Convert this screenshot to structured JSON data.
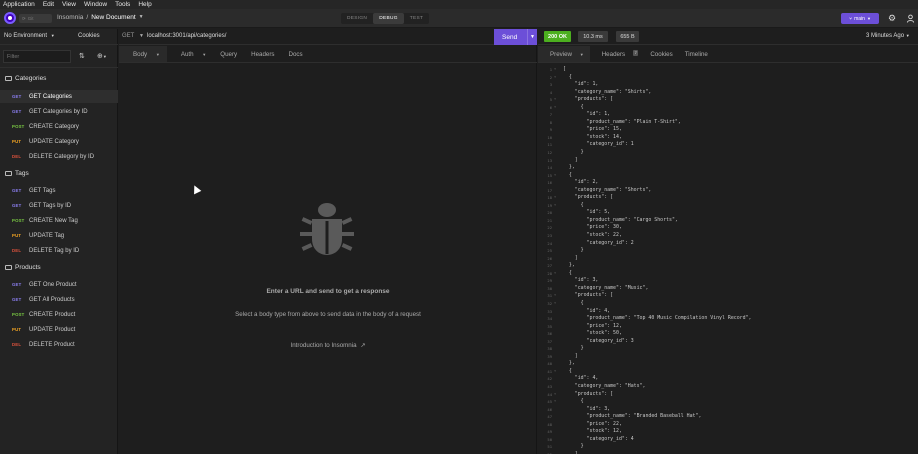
{
  "menu": [
    "Application",
    "Edit",
    "View",
    "Window",
    "Tools",
    "Help"
  ],
  "titlebar": {
    "git_label": "Git",
    "app_name": "Insomnia",
    "separator": "/",
    "document": "New Document",
    "modes": [
      "DESIGN",
      "DEBUG",
      "TEST"
    ],
    "active_mode": "DEBUG",
    "branch": "main"
  },
  "sidebar": {
    "environment": "No Environment",
    "cookies": "Cookies",
    "filter_placeholder": "Filter",
    "folders": [
      {
        "name": "Categories",
        "requests": [
          {
            "method": "GET",
            "name": "GET Categories"
          },
          {
            "method": "GET",
            "name": "GET Categories by ID"
          },
          {
            "method": "POST",
            "name": "CREATE Category"
          },
          {
            "method": "PUT",
            "name": "UPDATE Category"
          },
          {
            "method": "DEL",
            "name": "DELETE Category by ID"
          }
        ]
      },
      {
        "name": "Tags",
        "requests": [
          {
            "method": "GET",
            "name": "GET Tags"
          },
          {
            "method": "GET",
            "name": "GET Tags by ID"
          },
          {
            "method": "POST",
            "name": "CREATE New Tag"
          },
          {
            "method": "PUT",
            "name": "UPDATE Tag"
          },
          {
            "method": "DEL",
            "name": "DELETE Tag by ID"
          }
        ]
      },
      {
        "name": "Products",
        "requests": [
          {
            "method": "GET",
            "name": "GET One Product"
          },
          {
            "method": "GET",
            "name": "GET All Products"
          },
          {
            "method": "POST",
            "name": "CREATE Product"
          },
          {
            "method": "PUT",
            "name": "UPDATE Product"
          },
          {
            "method": "DEL",
            "name": "DELETE Product"
          }
        ]
      }
    ]
  },
  "method_colors": {
    "GET": "#8c7ff2",
    "POST": "#7ac943",
    "PUT": "#f5a623",
    "DEL": "#e0533d"
  },
  "request": {
    "method": "GET",
    "url": "localhost:3001/api/categories/",
    "send_label": "Send",
    "tabs": [
      "Body",
      "Auth",
      "Query",
      "Headers",
      "Docs"
    ],
    "empty_title": "Enter a URL and send to get a response",
    "empty_subtitle": "Select a body type from above to send data in the body of a request",
    "intro_link": "Introduction to Insomnia"
  },
  "response": {
    "status": "200 OK",
    "time": "10.3 ms",
    "size": "655 B",
    "ago": "3 Minutes Ago",
    "tabs": [
      "Preview",
      "Headers",
      "Cookies",
      "Timeline"
    ],
    "headers_count": "7",
    "status_color": "#4caf1f",
    "lines": [
      "[",
      "  {",
      "    \"id\": 1,",
      "    \"category_name\": \"Shirts\",",
      "    \"products\": [",
      "      {",
      "        \"id\": 1,",
      "        \"product_name\": \"Plain T-Shirt\",",
      "        \"price\": 15,",
      "        \"stock\": 14,",
      "        \"category_id\": 1",
      "      }",
      "    ]",
      "  },",
      "  {",
      "    \"id\": 2,",
      "    \"category_name\": \"Shorts\",",
      "    \"products\": [",
      "      {",
      "        \"id\": 5,",
      "        \"product_name\": \"Cargo Shorts\",",
      "        \"price\": 30,",
      "        \"stock\": 22,",
      "        \"category_id\": 2",
      "      }",
      "    ]",
      "  },",
      "  {",
      "    \"id\": 3,",
      "    \"category_name\": \"Music\",",
      "    \"products\": [",
      "      {",
      "        \"id\": 4,",
      "        \"product_name\": \"Top 40 Music Compilation Vinyl Record\",",
      "        \"price\": 12,",
      "        \"stock\": 50,",
      "        \"category_id\": 3",
      "      }",
      "    ]",
      "  },",
      "  {",
      "    \"id\": 4,",
      "    \"category_name\": \"Hats\",",
      "    \"products\": [",
      "      {",
      "        \"id\": 3,",
      "        \"product_name\": \"Branded Baseball Hat\",",
      "        \"price\": 22,",
      "        \"stock\": 12,",
      "        \"category_id\": 4",
      "      }",
      "    ]",
      "  },"
    ]
  }
}
